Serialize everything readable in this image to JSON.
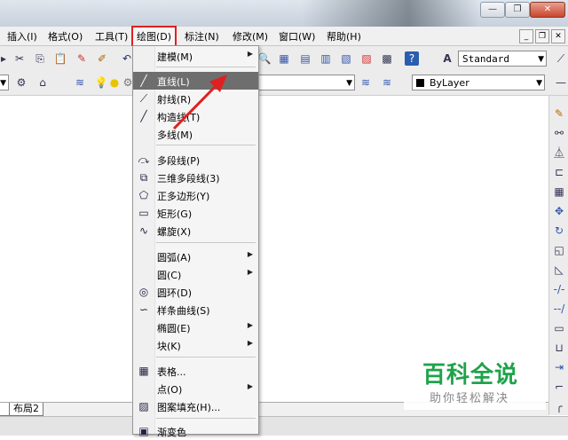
{
  "window": {
    "minimize": "—",
    "restore": "❐",
    "close": "✕"
  },
  "menubar": {
    "items": [
      {
        "label": "插入(I)"
      },
      {
        "label": "格式(O)"
      },
      {
        "label": "工具(T)"
      },
      {
        "label": "绘图(D)",
        "active": true
      },
      {
        "label": "标注(N)"
      },
      {
        "label": "修改(M)"
      },
      {
        "label": "窗口(W)"
      },
      {
        "label": "帮助(H)"
      }
    ],
    "mdi_min": "_",
    "mdi_restore": "❐",
    "mdi_close": "✕"
  },
  "toolbar": {
    "text_style": "Standard",
    "linetype": "ByLayer",
    "layer_combo": ""
  },
  "draw_menu": {
    "items": [
      {
        "label": "建模(M)",
        "submenu": true
      },
      {
        "label": "直线(L)",
        "icon": "line-icon",
        "highlighted": true
      },
      {
        "label": "射线(R)",
        "icon": "ray-icon"
      },
      {
        "label": "构造线(T)",
        "icon": "construction-line-icon"
      },
      {
        "label": "多线(M)"
      },
      {
        "label": "多段线(P)",
        "icon": "polyline-icon"
      },
      {
        "label": "三维多段线(3)",
        "icon": "3d-polyline-icon"
      },
      {
        "label": "正多边形(Y)",
        "icon": "polygon-icon"
      },
      {
        "label": "矩形(G)",
        "icon": "rectangle-icon"
      },
      {
        "label": "螺旋(X)",
        "icon": "helix-icon"
      },
      {
        "label": "圆弧(A)",
        "submenu": true
      },
      {
        "label": "圆(C)",
        "submenu": true
      },
      {
        "label": "圆环(D)",
        "icon": "donut-icon"
      },
      {
        "label": "样条曲线(S)",
        "icon": "spline-icon"
      },
      {
        "label": "椭圆(E)",
        "submenu": true
      },
      {
        "label": "块(K)",
        "submenu": true
      },
      {
        "label": "表格...",
        "icon": "table-icon"
      },
      {
        "label": "点(O)",
        "submenu": true
      },
      {
        "label": "图案填充(H)...",
        "icon": "hatch-icon"
      },
      {
        "label": "渐变色",
        "icon": "gradient-icon"
      }
    ]
  },
  "layout_tab": "布局2",
  "watermark": {
    "title": "百科全说",
    "subtitle": "助你轻松解决"
  },
  "colors": {
    "highlight": "#6e6e6e",
    "annotation_red": "#e02020",
    "watermark_green": "#1fa34a"
  }
}
